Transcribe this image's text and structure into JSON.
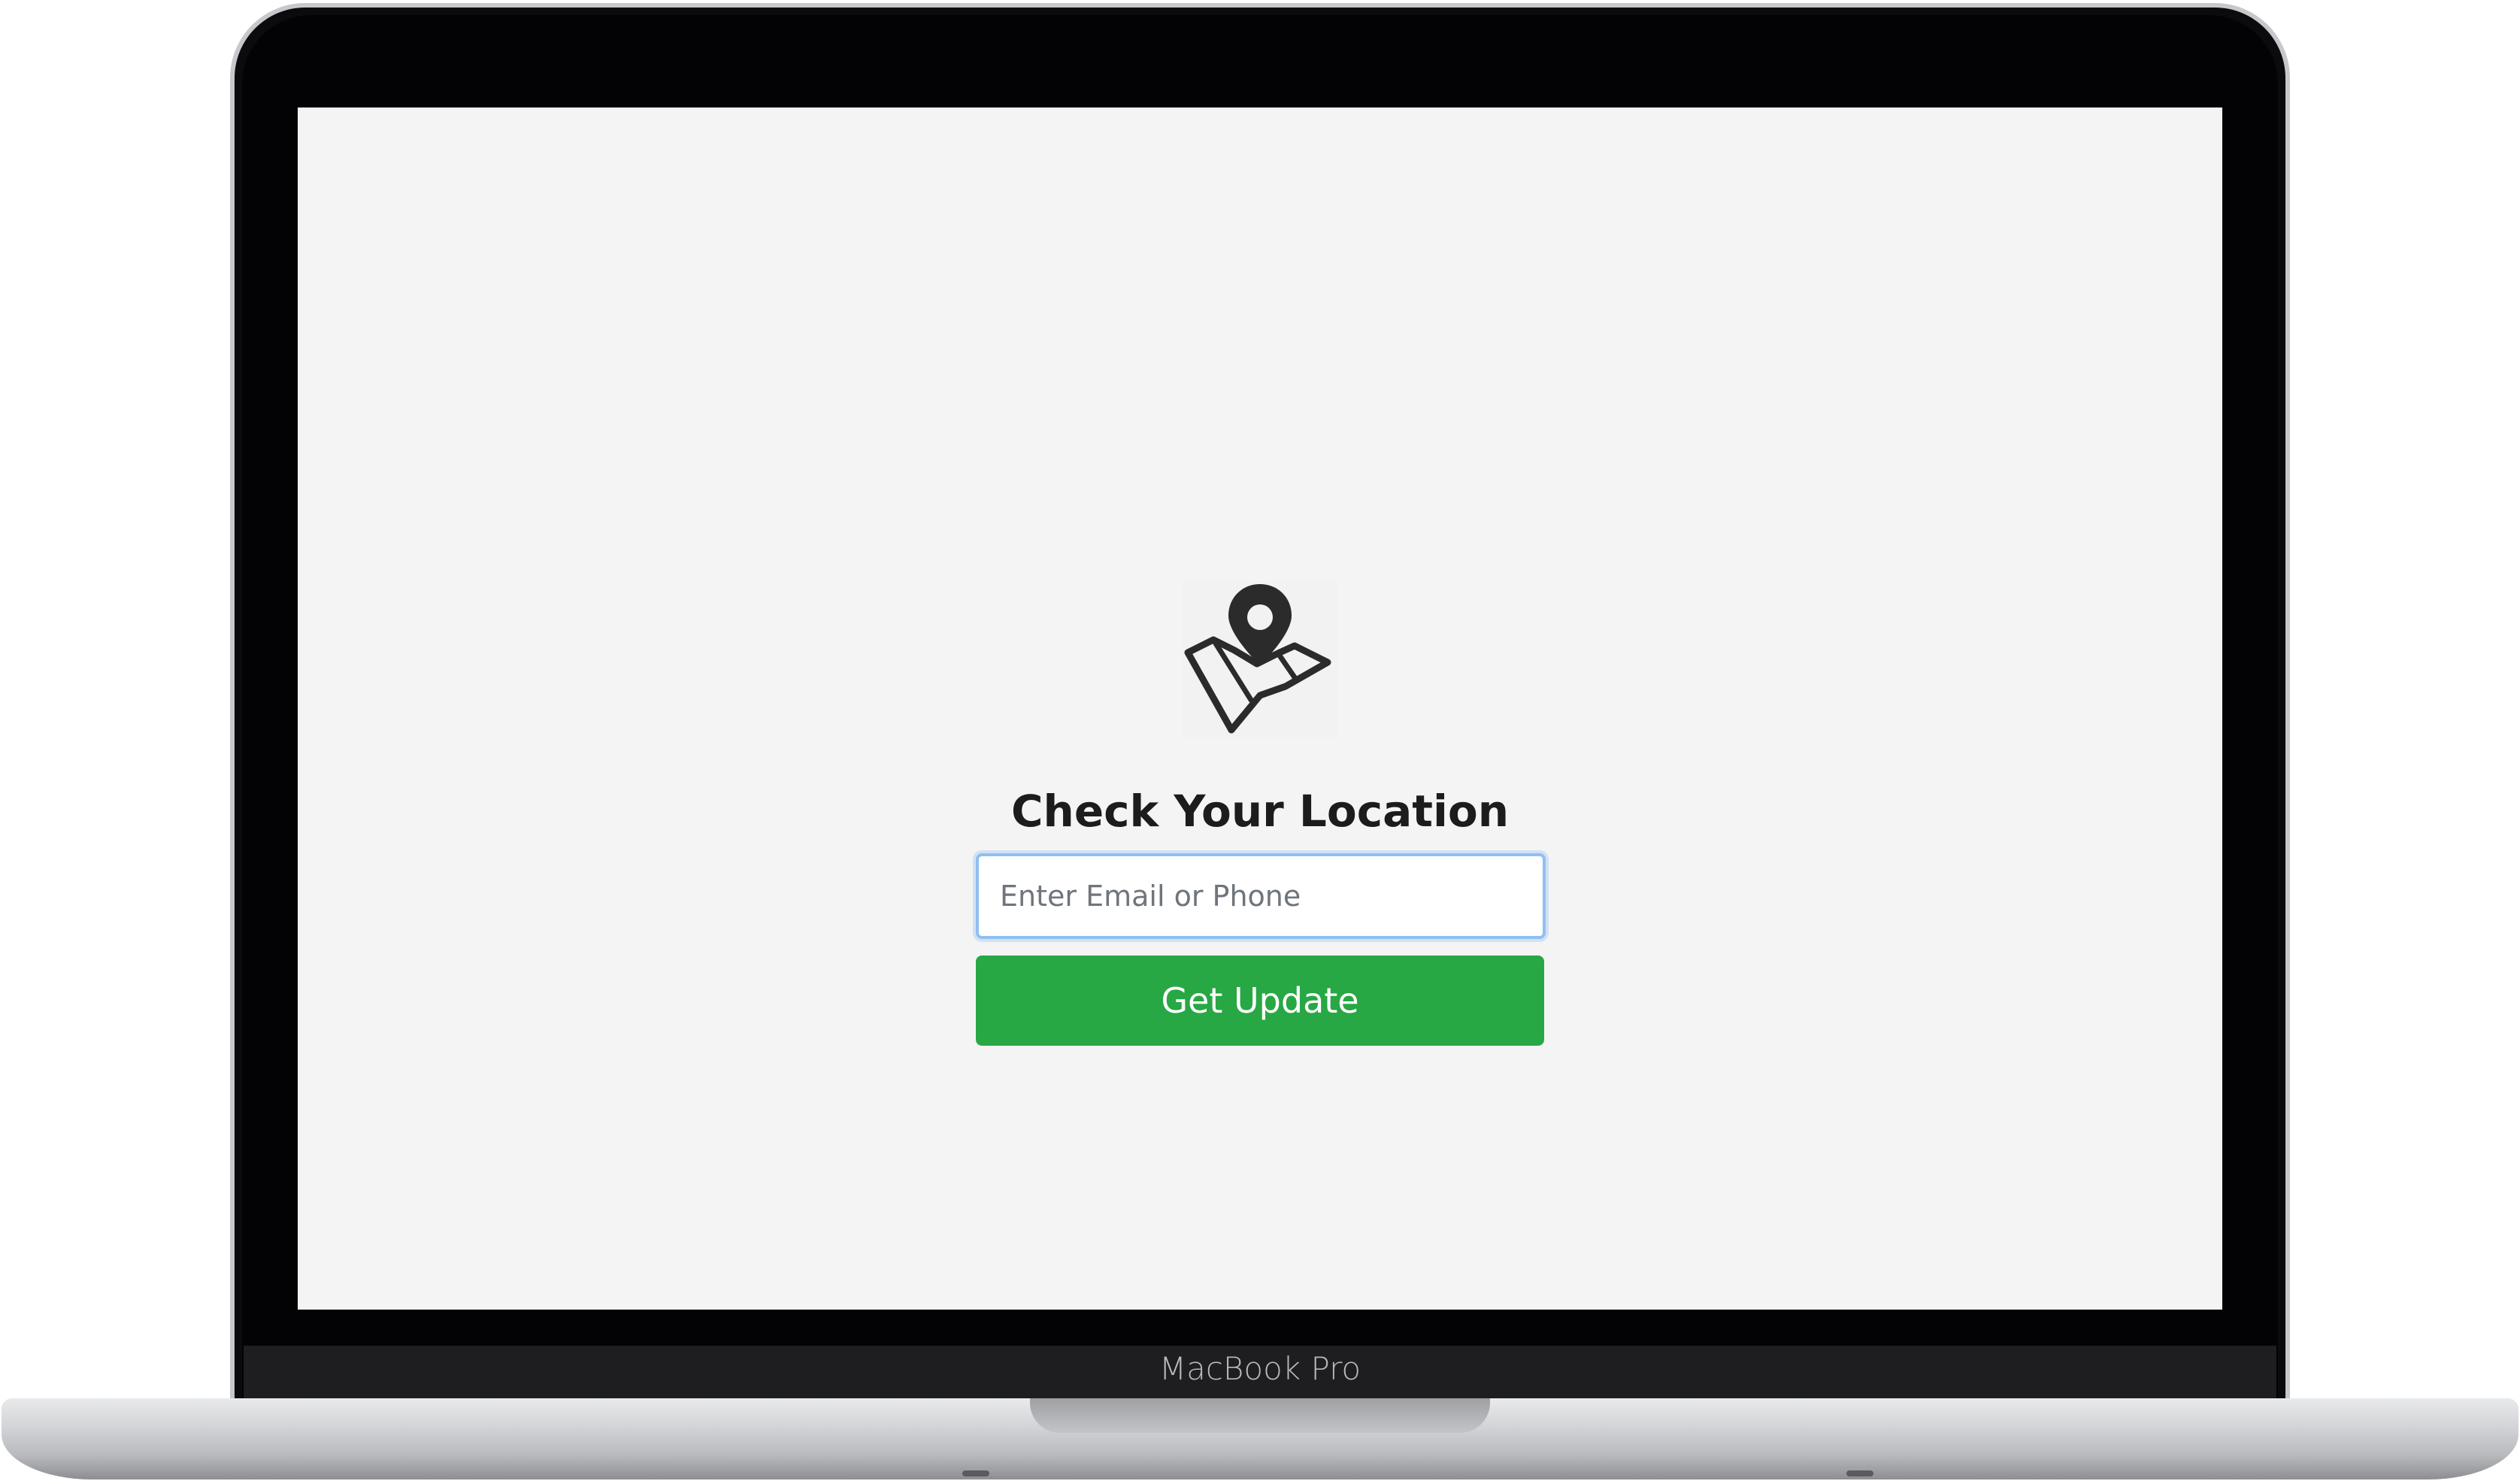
{
  "device": {
    "brand_label": "MacBook Pro"
  },
  "app": {
    "logo_icon": "map-pin-icon",
    "title": "Check Your Location",
    "input": {
      "placeholder": "Enter Email or Phone",
      "value": ""
    },
    "button_label": "Get Update",
    "colors": {
      "button_bg": "#28a745",
      "button_text": "#ffffff",
      "input_focus_border": "#8fbff2",
      "background": "#f4f4f4"
    }
  }
}
